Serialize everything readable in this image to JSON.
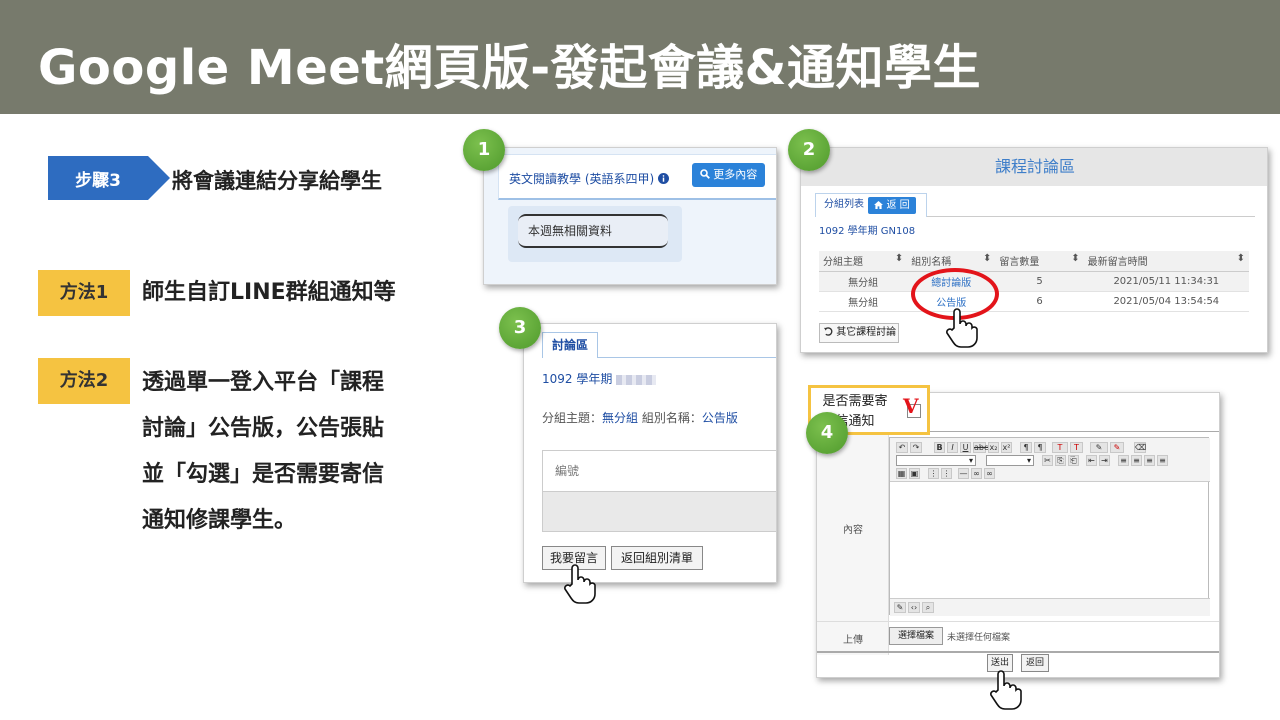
{
  "title": "Google Meet網頁版-發起會議&通知學生",
  "step": {
    "badge": "步驟3",
    "text": "將會議連結分享給學生"
  },
  "methods": [
    {
      "badge": "方法1",
      "lines": [
        "師生自訂LINE群組通知等"
      ]
    },
    {
      "badge": "方法2",
      "lines": [
        "透過單一登入平台「課程",
        "討論」公告版，公告張貼",
        "並「勾選」是否需要寄信",
        "通知修課學生。"
      ]
    }
  ],
  "numbers": [
    "1",
    "2",
    "3",
    "4"
  ],
  "panel1": {
    "course": "英文閱讀教學 (英語系四甲)",
    "more_button": "更多內容",
    "empty_text": "本週無相關資料"
  },
  "panel2": {
    "header": "課程討論區",
    "tab_label": "分組列表",
    "back_button": "返 回",
    "term": "1092 學年期 GN108",
    "columns": [
      "分組主題",
      "組別名稱",
      "留言數量",
      "最新留言時間"
    ],
    "rows": [
      [
        "無分組",
        "總討論版",
        "5",
        "2021/05/11 11:34:31"
      ],
      [
        "無分組",
        "公告版",
        "6",
        "2021/05/04 13:54:54"
      ]
    ],
    "other_button": "其它課程討論",
    "highlight_color": "#e3141a"
  },
  "panel3": {
    "tab": "討論區",
    "term": "1092 學年期",
    "topic_label": "分組主題：",
    "topic_value": "無分組",
    "group_label": "組別名稱：",
    "group_value": "公告版",
    "field_label": "編號",
    "button_post": "我要留言",
    "button_back": "返回組別清單"
  },
  "panel4": {
    "notify_label_line1": "是否需要寄",
    "notify_label_line2": "信通知",
    "check_mark": "V",
    "content_label": "內容",
    "upload_label": "上傳",
    "choose_file": "選擇檔案",
    "no_file": "未選擇任何檔案",
    "submit": "送出",
    "back": "返回"
  },
  "colors": {
    "title_bg": "#777a6c",
    "step_blue": "#2e6cc0",
    "method_yellow": "#f5c341",
    "badge_green": "#5aa437"
  },
  "icons": [
    "info-icon",
    "search-icon",
    "home-icon",
    "sort-icon",
    "undo-icon",
    "hand-pointer-icon"
  ]
}
